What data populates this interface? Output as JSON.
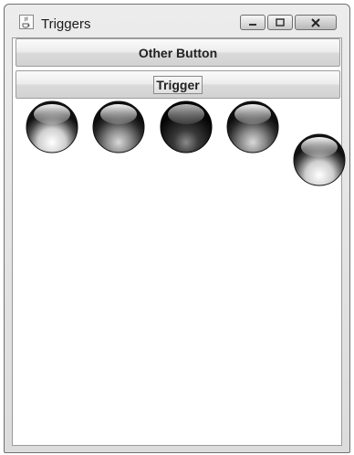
{
  "window": {
    "title": "Triggers",
    "icon": "java-cup-icon"
  },
  "titlebar_buttons": [
    "minimize-icon",
    "maximize-icon",
    "close-icon"
  ],
  "buttons": {
    "other_label": "Other Button",
    "trigger_label": "Trigger"
  },
  "balls": [
    {
      "name": "ball-1",
      "shade": "light"
    },
    {
      "name": "ball-2",
      "shade": "medium"
    },
    {
      "name": "ball-3",
      "shade": "dark"
    },
    {
      "name": "ball-4",
      "shade": "medium"
    },
    {
      "name": "ball-5",
      "shade": "light"
    }
  ],
  "colors": {
    "ball_dark": "#111111",
    "ball_mid": "#555555",
    "ball_light": "#f2f2f2"
  }
}
